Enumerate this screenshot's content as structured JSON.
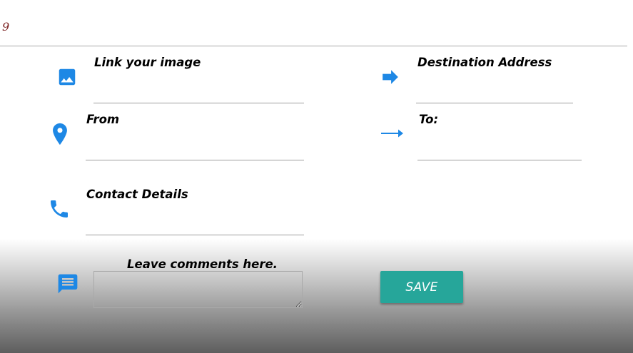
{
  "header": {
    "page_number": "9"
  },
  "colors": {
    "icon_accent": "#1e88e5",
    "save_button_bg": "#26a69a",
    "page_number_color": "#7a1f1f"
  },
  "fields": {
    "image_link": {
      "label": "Link your image",
      "icon": "image-icon",
      "value": ""
    },
    "destination": {
      "label": "Destination Address",
      "icon": "arrow-forward-icon",
      "value": ""
    },
    "from": {
      "label": "From",
      "icon": "location-pin-icon",
      "value": ""
    },
    "to": {
      "label": "To:",
      "icon": "arrow-right-icon",
      "value": ""
    },
    "contact": {
      "label": "Contact Details",
      "icon": "phone-icon",
      "value": ""
    },
    "comments": {
      "label": "Leave comments here.",
      "icon": "comment-icon",
      "value": ""
    }
  },
  "actions": {
    "save_label": "SAVE"
  }
}
